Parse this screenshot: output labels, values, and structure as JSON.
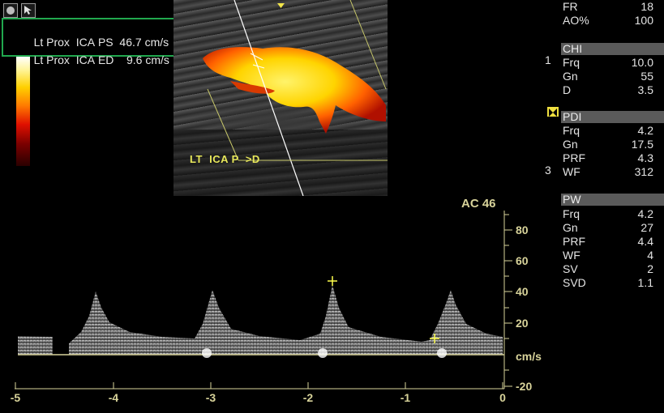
{
  "icons": [
    "record-icon",
    "cursor-icon"
  ],
  "measurements": [
    {
      "side": "Lt",
      "location": "Prox",
      "vessel": "ICA",
      "param": "PS",
      "value": "46.7",
      "unit": "cm/s"
    },
    {
      "side": "Lt",
      "location": "Prox",
      "vessel": "ICA",
      "param": "ED",
      "value": "9.6",
      "unit": "cm/s"
    }
  ],
  "image_annotation": "LT  ICA P  >D",
  "panel": {
    "general": [
      {
        "label": "FR",
        "value": "18"
      },
      {
        "label": "AO%",
        "value": "100"
      }
    ],
    "chi": {
      "title": "CHI",
      "rows": [
        {
          "label": "Frq",
          "value": "10.0"
        },
        {
          "label": "Gn",
          "value": "55"
        },
        {
          "label": "D",
          "value": "3.5"
        }
      ]
    },
    "pdi": {
      "title": "PDI",
      "rows": [
        {
          "label": "Frq",
          "value": "4.2"
        },
        {
          "label": "Gn",
          "value": "17.5"
        },
        {
          "label": "PRF",
          "value": "4.3"
        },
        {
          "label": "WF",
          "value": "312"
        }
      ]
    },
    "pw": {
      "title": "PW",
      "rows": [
        {
          "label": "Frq",
          "value": "4.2"
        },
        {
          "label": "Gn",
          "value": "27"
        },
        {
          "label": "PRF",
          "value": "4.4"
        },
        {
          "label": "WF",
          "value": "4"
        },
        {
          "label": "SV",
          "value": "2"
        },
        {
          "label": "SVD",
          "value": "1.1"
        }
      ]
    },
    "depth_marks": [
      "1",
      "3"
    ]
  },
  "doppler": {
    "ac_label": "AC 46",
    "y_ticks": [
      "80",
      "60",
      "40",
      "20",
      "cm/s",
      "-20"
    ],
    "x_ticks": [
      "-5",
      "-4",
      "-3",
      "-2",
      "-1",
      "0"
    ],
    "colors": {
      "accent": "#d8d39a",
      "marker": "#ffff4d",
      "baseline": "#d8d39a"
    }
  }
}
